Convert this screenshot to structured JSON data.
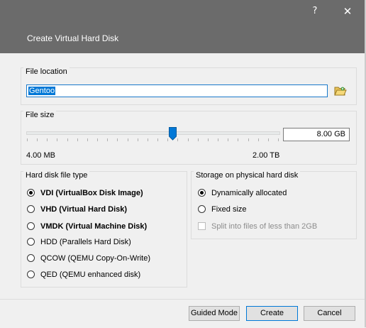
{
  "window": {
    "title": "Create Virtual Hard Disk",
    "help_glyph": "?",
    "close_glyph": "✕"
  },
  "file_location": {
    "group_label": "File location",
    "value": "Gentoo",
    "browse_icon": "folder-icon"
  },
  "file_size": {
    "group_label": "File size",
    "value": "8.00 GB",
    "min_label": "4.00 MB",
    "max_label": "2.00 TB",
    "slider_position_fraction": 0.58
  },
  "disk_type": {
    "group_label": "Hard disk file type",
    "options": [
      {
        "label": "VDI (VirtualBox Disk Image)",
        "checked": true,
        "bold": true
      },
      {
        "label": "VHD (Virtual Hard Disk)",
        "checked": false,
        "bold": true
      },
      {
        "label": "VMDK (Virtual Machine Disk)",
        "checked": false,
        "bold": true
      },
      {
        "label": "HDD (Parallels Hard Disk)",
        "checked": false,
        "bold": false
      },
      {
        "label": "QCOW (QEMU Copy-On-Write)",
        "checked": false,
        "bold": false
      },
      {
        "label": "QED (QEMU enhanced disk)",
        "checked": false,
        "bold": false
      }
    ]
  },
  "storage": {
    "group_label": "Storage on physical hard disk",
    "options": [
      {
        "label": "Dynamically allocated",
        "checked": true
      },
      {
        "label": "Fixed size",
        "checked": false
      }
    ],
    "split_label": "Split into files of less than 2GB",
    "split_checked": false,
    "split_enabled": false
  },
  "buttons": {
    "guided_mode": "Guided Mode",
    "create": "Create",
    "cancel": "Cancel"
  },
  "colors": {
    "titlebar": "#6b6b6b",
    "accent": "#0078d7"
  }
}
